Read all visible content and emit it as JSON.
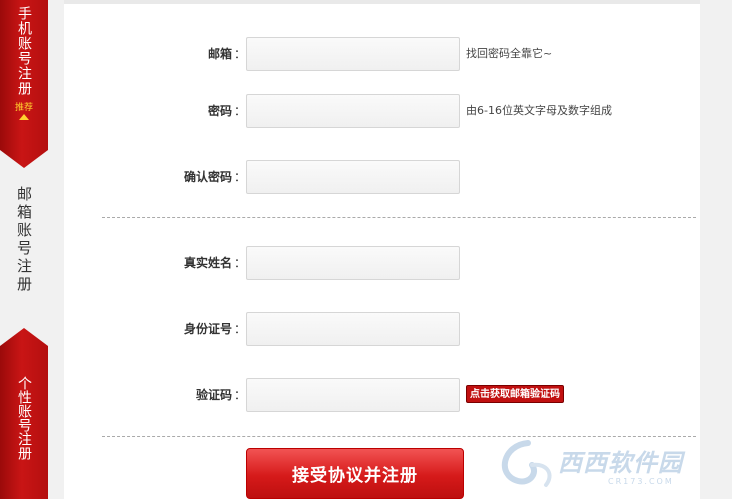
{
  "tabs": {
    "mobile": {
      "label": "手机账号注册",
      "badge": "推荐"
    },
    "email": {
      "label": "邮箱账号注册"
    },
    "custom": {
      "label": "个性账号注册"
    }
  },
  "form": {
    "email": {
      "label": "邮箱",
      "value": "",
      "hint": "找回密码全靠它~"
    },
    "password": {
      "label": "密码",
      "value": "",
      "hint": "由6-16位英文字母及数字组成"
    },
    "confirm": {
      "label": "确认密码",
      "value": ""
    },
    "real_name": {
      "label": "真实姓名",
      "value": ""
    },
    "id_number": {
      "label": "身份证号",
      "value": ""
    },
    "code": {
      "label": "验证码",
      "value": "",
      "button": "点击获取邮箱验证码"
    },
    "colon": "：",
    "submit": "接受协议并注册"
  },
  "watermark": {
    "text": "西西软件园",
    "sub": "CR173.COM"
  },
  "colors": {
    "accent": "#c91515",
    "button": "#d61a1a",
    "hint_button": "#c11010"
  }
}
